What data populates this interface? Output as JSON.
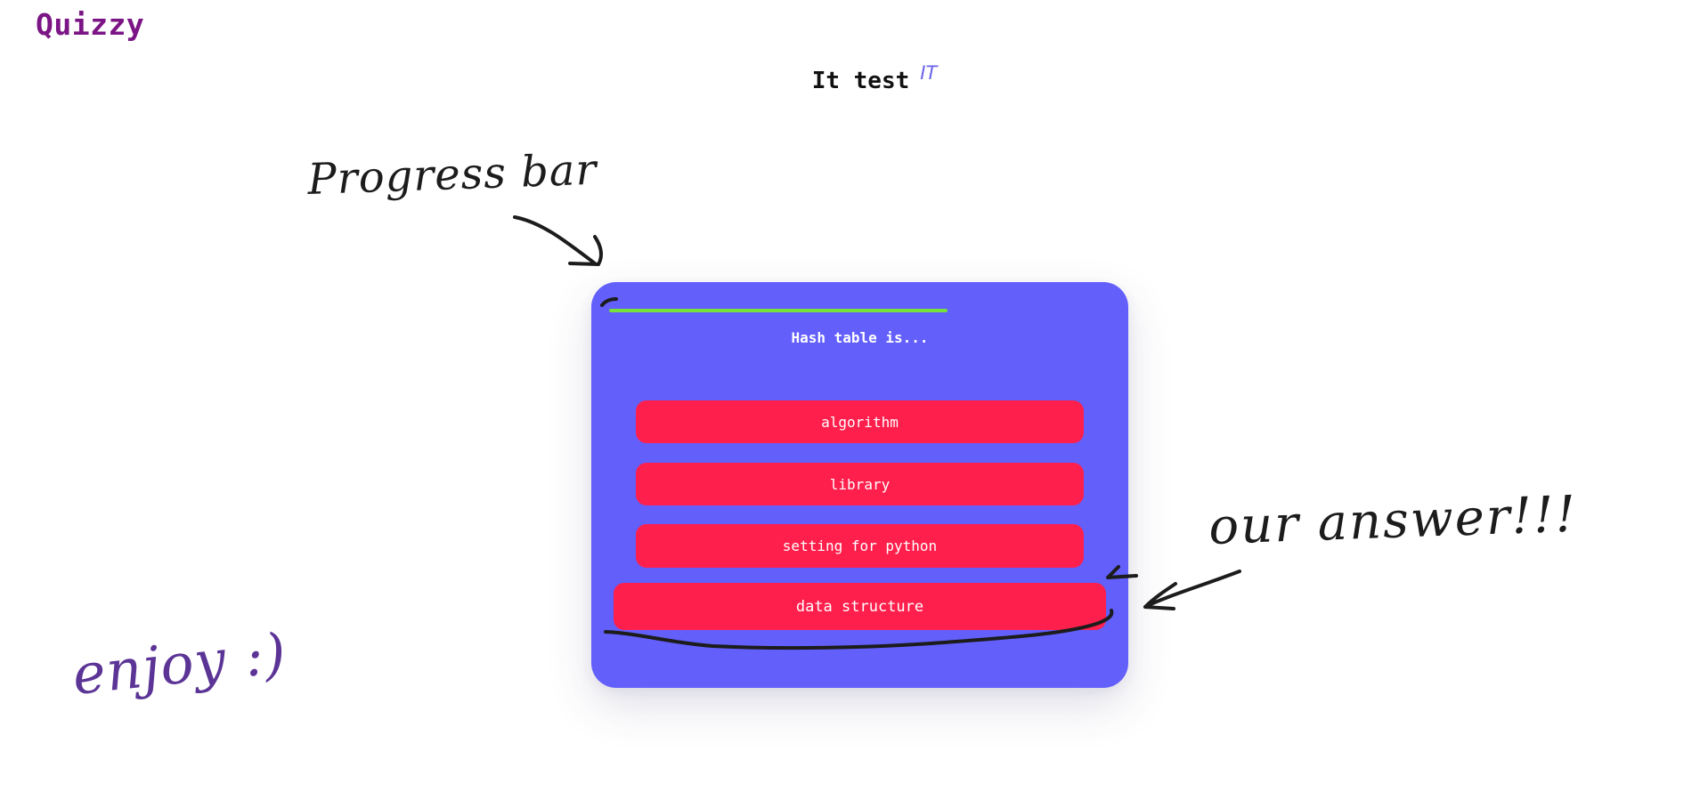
{
  "app": {
    "logo": "Quizzy"
  },
  "header": {
    "title": "It test",
    "category": "IT"
  },
  "quiz": {
    "progress": 0.72,
    "question": "Hash table is...",
    "answers": [
      {
        "label": "algorithm"
      },
      {
        "label": "library"
      },
      {
        "label": "setting for python"
      },
      {
        "label": "data structure",
        "highlighted": true
      }
    ]
  },
  "annotations": {
    "progress_note": "Progress bar",
    "answer_note": "our answer!!!",
    "enjoy_note": "enjoy :)"
  },
  "colors": {
    "logo": "#7b1585",
    "card_background": "#625ffb",
    "answer_button": "#ff1f4c",
    "progress_fill": "#77e03b",
    "category_tag": "#6a63e8",
    "ink_dark": "#1c1c1c",
    "ink_purple": "#5b3496"
  }
}
